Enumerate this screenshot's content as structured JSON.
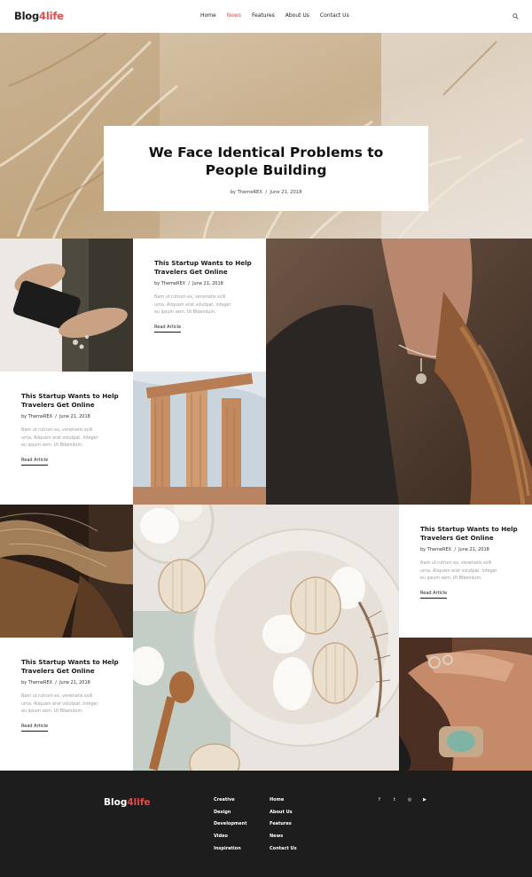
{
  "brand": {
    "logo_dark": "Blog",
    "logo_num": "4",
    "logo_light": "life",
    "accent": "#e04b4b"
  },
  "nav": {
    "items": [
      {
        "label": "Home",
        "active": false
      },
      {
        "label": "News",
        "active": true
      },
      {
        "label": "Features",
        "active": false
      },
      {
        "label": "About Us",
        "active": false
      },
      {
        "label": "Contact Us",
        "active": false
      }
    ],
    "search_icon": "search-icon"
  },
  "hero": {
    "title_line1": "We Face Identical Problems to",
    "title_line2": "People Building",
    "meta_author": "by ThemeREX",
    "meta_sep": "/",
    "meta_date": "June 21, 2018"
  },
  "cards": [
    {
      "title_line1": "This Startup Wants to Help",
      "title_line2": "Travelers Get Online",
      "author": "by ThemeREX",
      "date": "June 21, 2018",
      "excerpt": [
        "Nam ut rutrum ex, venenatis solli",
        "urna. Aliquam erat volutpat. Integer",
        "eu ipsum sem. Ut Bibendum."
      ],
      "link": "Read Article"
    },
    {
      "title_line1": "This Startup Wants to Help",
      "title_line2": "Travelers Get Online",
      "author": "by ThemeREX",
      "date": "June 21, 2018",
      "excerpt": [
        "Nam ut rutrum ex, venenatis solli",
        "urna. Aliquam erat volutpat. Integer",
        "eu ipsum sem. Ut Bibendum."
      ],
      "link": "Read Article"
    },
    {
      "title_line1": "This Startup Wants to Help",
      "title_line2": "Travelers Get Online",
      "author": "by ThemeREX",
      "date": "June 21, 2018",
      "excerpt": [
        "Nam ut rutrum ex, venenatis solli",
        "urna. Aliquam erat volutpat. Integer",
        "eu ipsum sem. Ut Bibendum."
      ],
      "link": "Read Article"
    },
    {
      "title_line1": "This Startup Wants to Help",
      "title_line2": "Travelers Get Online",
      "author": "by ThemeREX",
      "date": "June 21, 2018",
      "excerpt": [
        "Nam ut rutrum ex, venenatis solli",
        "urna. Aliquam erat volutpat. Integer",
        "eu ipsum sem. Ut Bibendum."
      ],
      "link": "Read Article"
    }
  ],
  "footer": {
    "logo_light": "Blog",
    "logo_accent": "4",
    "logo_end": "life",
    "col1": [
      "Creative",
      "Design",
      "Development",
      "Video",
      "Inspiration"
    ],
    "col2": [
      "Home",
      "About Us",
      "Features",
      "News",
      "Contact Us"
    ],
    "social": [
      {
        "icon": "facebook-icon",
        "glyph": "f"
      },
      {
        "icon": "twitter-icon",
        "glyph": "t"
      },
      {
        "icon": "instagram-icon",
        "glyph": "◎"
      },
      {
        "icon": "youtube-icon",
        "glyph": "▶"
      }
    ]
  }
}
